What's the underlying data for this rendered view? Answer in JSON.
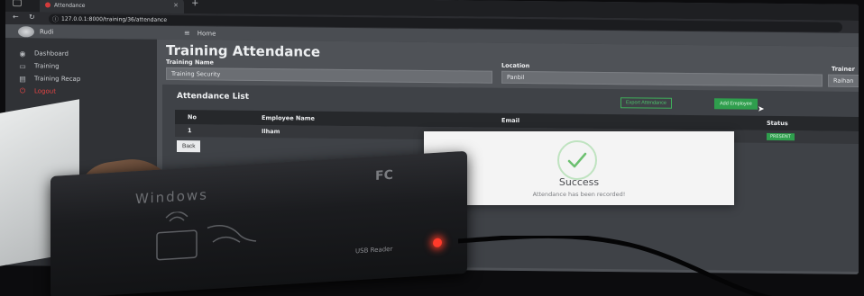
{
  "browser": {
    "tab_title": "Attendance",
    "url": "127.0.0.1:8000/training/36/attendance"
  },
  "app": {
    "user_name": "Rudi",
    "breadcrumb": "Home"
  },
  "sidebar": {
    "items": [
      {
        "label": "Dashboard",
        "icon": "dashboard-icon"
      },
      {
        "label": "Training",
        "icon": "training-icon"
      },
      {
        "label": "Training Recap",
        "icon": "chart-icon"
      },
      {
        "label": "Logout",
        "icon": "logout-icon"
      }
    ]
  },
  "page": {
    "title": "Training Attendance",
    "fields": {
      "training_name_label": "Training Name",
      "training_name_value": "Training Security",
      "location_label": "Location",
      "location_value": "Panbil",
      "trainer_label": "Trainer",
      "trainer_value": "Raihan"
    }
  },
  "attendance": {
    "title": "Attendance List",
    "export_label": "Export Attendance",
    "add_label": "Add Employee",
    "columns": [
      "No",
      "Employee Name",
      "Email",
      "Status"
    ],
    "rows": [
      {
        "no": "1",
        "name": "Ilham",
        "email": "",
        "status": "PRESENT"
      }
    ],
    "back_label": "Back"
  },
  "modal": {
    "title": "Success",
    "message": "Attendance has been recorded!"
  },
  "device": {
    "brand": "Windows",
    "fc_mark": "FC",
    "label": "USB Reader"
  },
  "colors": {
    "accent_green": "#2f9e4d",
    "logout_red": "#e24444",
    "led_red": "#ff3a2a"
  }
}
